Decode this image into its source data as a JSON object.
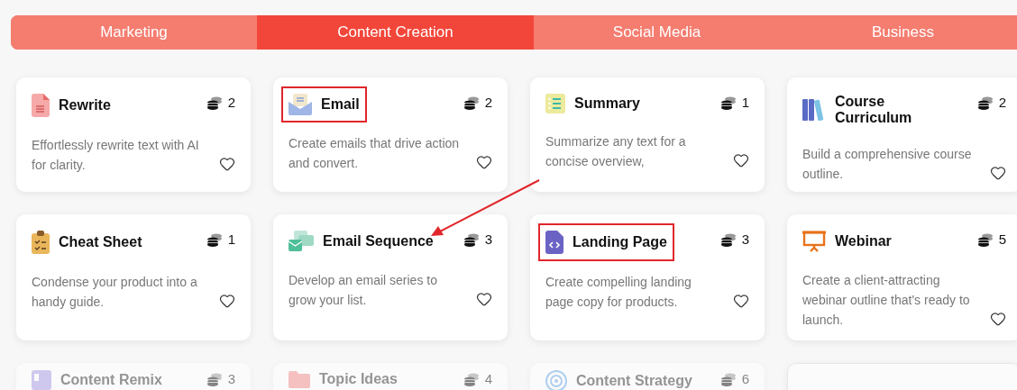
{
  "tabs": [
    {
      "label": "Marketing",
      "selected": false
    },
    {
      "label": "Content Creation",
      "selected": true
    },
    {
      "label": "Social Media",
      "selected": false
    },
    {
      "label": "Business",
      "selected": false
    }
  ],
  "rows": [
    {
      "faded": false,
      "cards": [
        {
          "title": "Rewrite",
          "cost": "2",
          "description": "Effortlessly rewrite text with AI for clarity.",
          "highlighted": false
        },
        {
          "title": "Email",
          "cost": "2",
          "description": "Create emails that drive action and convert.",
          "highlighted": true
        },
        {
          "title": "Summary",
          "cost": "1",
          "description": "Summarize any text for a concise overview,",
          "highlighted": false
        },
        {
          "title": "Course Curriculum",
          "cost": "2",
          "description": "Build a comprehensive course outline.",
          "highlighted": false
        }
      ]
    },
    {
      "faded": false,
      "cards": [
        {
          "title": "Cheat Sheet",
          "cost": "1",
          "description": "Condense your product into a handy guide.",
          "highlighted": false
        },
        {
          "title": "Email Sequence",
          "cost": "3",
          "description": "Develop an email series to grow your list.",
          "highlighted": false
        },
        {
          "title": "Landing Page",
          "cost": "3",
          "description": "Create compelling landing page copy for products.",
          "highlighted": true
        },
        {
          "title": "Webinar",
          "cost": "5",
          "description": "Create a client-attracting webinar outline that's ready to launch.",
          "highlighted": false
        }
      ]
    },
    {
      "faded": true,
      "cards": [
        {
          "title": "Content Remix",
          "cost": "3",
          "highlighted": false
        },
        {
          "title": "Topic Ideas",
          "cost": "4",
          "highlighted": false
        },
        {
          "title": "Content Strategy",
          "cost": "6",
          "highlighted": false
        }
      ]
    }
  ]
}
